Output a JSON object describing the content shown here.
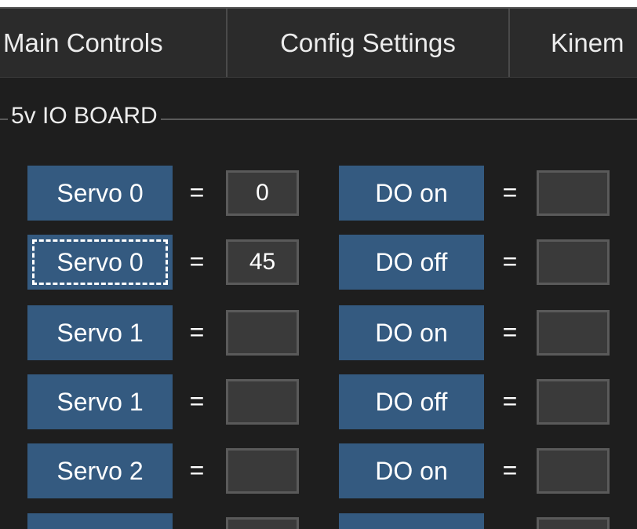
{
  "tabs": [
    {
      "label": "Main Controls"
    },
    {
      "label": "Config Settings"
    },
    {
      "label": "Kinem"
    }
  ],
  "group": {
    "title": "5v IO BOARD"
  },
  "equals": "=",
  "rows": [
    {
      "servo_label": "Servo 0",
      "servo_value": "0",
      "do_label": "DO on",
      "do_value": ""
    },
    {
      "servo_label": "Servo 0",
      "servo_value": "45",
      "do_label": "DO off",
      "do_value": ""
    },
    {
      "servo_label": "Servo 1",
      "servo_value": "",
      "do_label": "DO on",
      "do_value": ""
    },
    {
      "servo_label": "Servo 1",
      "servo_value": "",
      "do_label": "DO off",
      "do_value": ""
    },
    {
      "servo_label": "Servo 2",
      "servo_value": "",
      "do_label": "DO on",
      "do_value": ""
    }
  ],
  "colors": {
    "background": "#1e1e1e",
    "button": "#345a80",
    "field": "#3a3a3a",
    "tab_bar": "#2b2b2b"
  }
}
